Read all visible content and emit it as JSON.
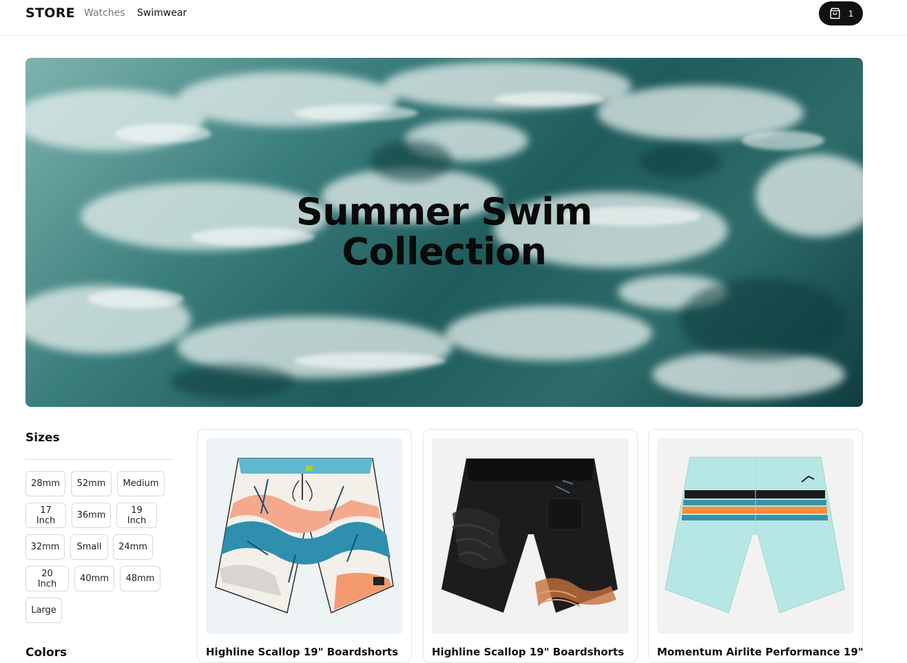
{
  "header": {
    "logo": "STORE",
    "nav": [
      {
        "label": "Watches"
      },
      {
        "label": "Swimwear"
      }
    ],
    "cart_count": "1",
    "cart_icon": "shopping-bag-icon"
  },
  "hero": {
    "title_line1": "Summer Swim",
    "title_line2": "Collection"
  },
  "filters": {
    "sizes_title": "Sizes",
    "sizes": [
      "28mm",
      "52mm",
      "Medium",
      "17 Inch",
      "36mm",
      "19 Inch",
      "32mm",
      "Small",
      "24mm",
      "20 Inch",
      "40mm",
      "48mm",
      "Large"
    ],
    "colors_title": "Colors"
  },
  "products": [
    {
      "name": "Highline Scallop 19\" Boardshorts",
      "image_bg": "#eef3f6"
    },
    {
      "name": "Highline Scallop 19\" Boardshorts",
      "image_bg": "#f2f2f2"
    },
    {
      "name": "Momentum Airlite Performance 19\"",
      "image_bg": "#f2f2f2"
    }
  ]
}
